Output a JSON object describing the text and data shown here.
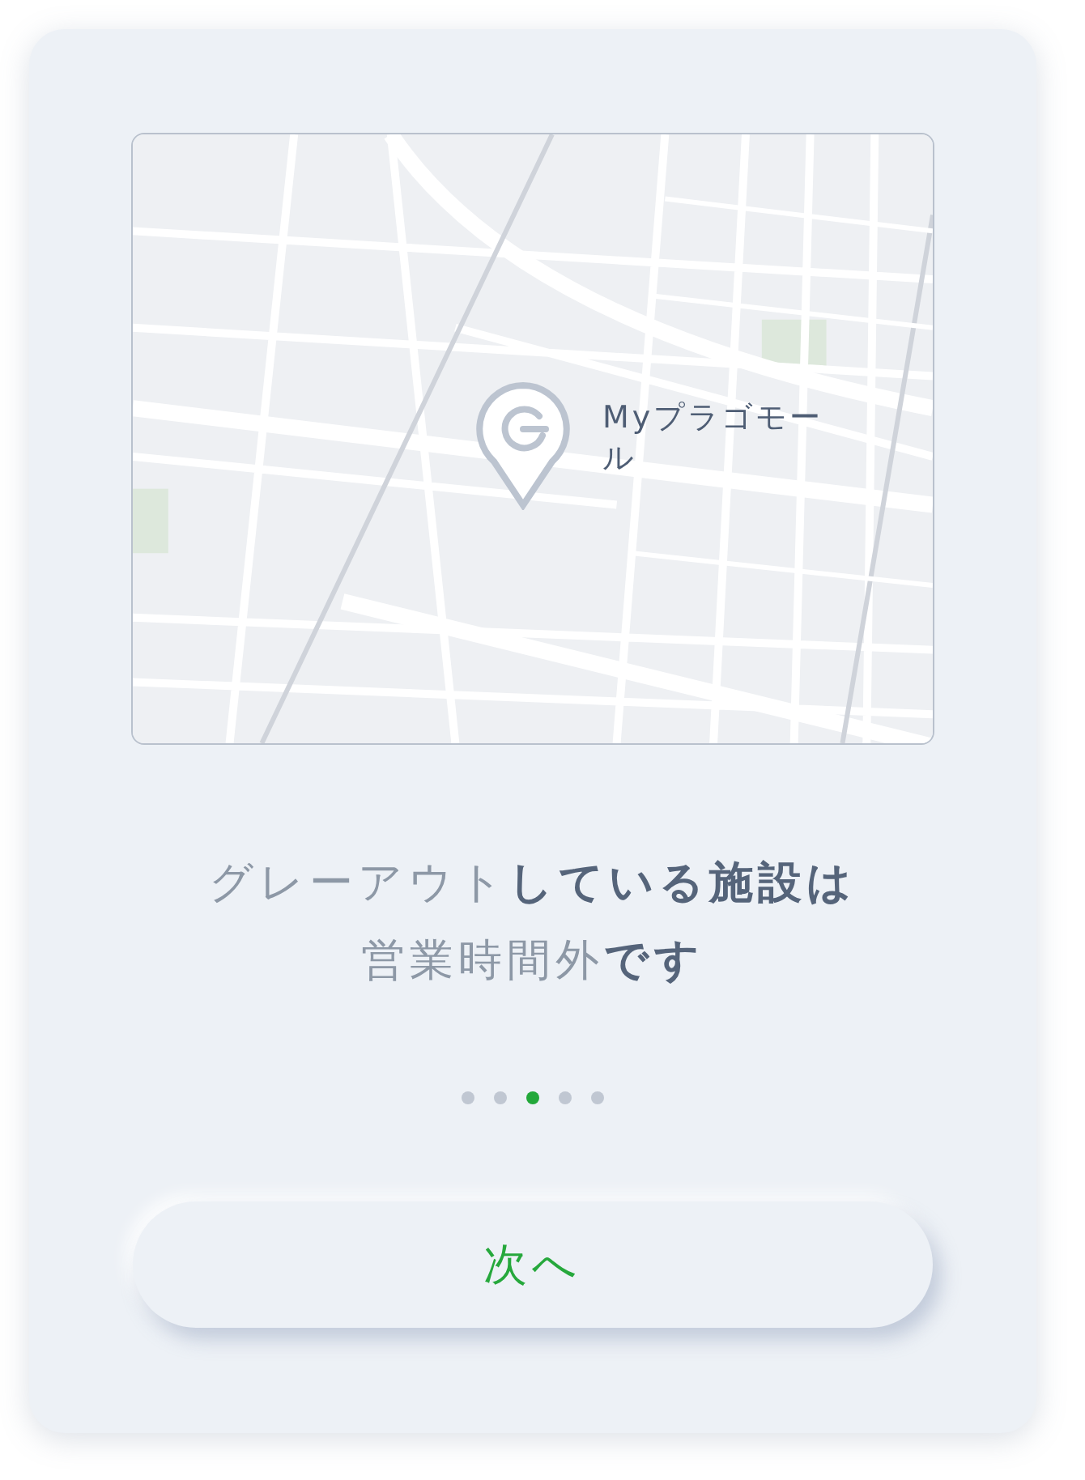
{
  "map": {
    "pin": {
      "label": "Myプラゴモール"
    }
  },
  "message": {
    "lines": [
      [
        {
          "text": "グレーアウト",
          "muted": true
        },
        {
          "text": "している施設は",
          "muted": false
        }
      ],
      [
        {
          "text": "営業時間外",
          "muted": true
        },
        {
          "text": "です",
          "muted": false
        }
      ]
    ]
  },
  "pager": [
    {
      "selected": false
    },
    {
      "selected": false
    },
    {
      "selected": true
    },
    {
      "selected": false
    },
    {
      "selected": false
    }
  ],
  "button": {
    "label": "次へ"
  }
}
